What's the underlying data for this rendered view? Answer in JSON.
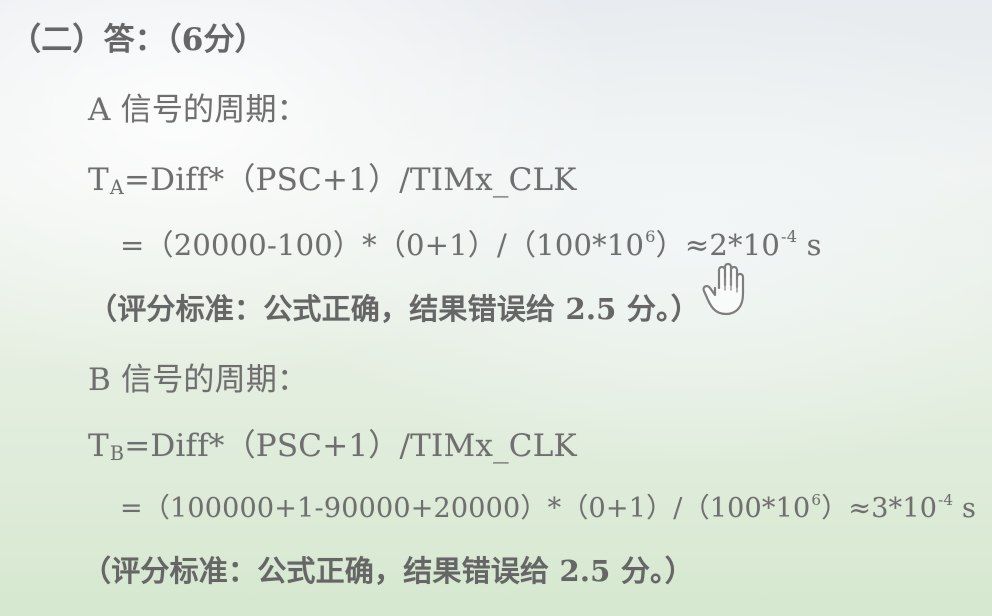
{
  "document": {
    "heading": "（二）答：（6分）",
    "a_title": "A 信号的周期：",
    "a_formula": {
      "symbol": "T",
      "subscript": "A",
      "rest": "=Diff*（PSC+1）/TIMx_CLK"
    },
    "a_calc": {
      "main": "=（20000-100）*（0+1）/（100*10",
      "exp1": "6",
      "mid": "）≈2*10",
      "exp2": "-4",
      "unit": " s"
    },
    "a_note": "（评分标准：公式正确，结果错误给 2.5 分。）",
    "b_title": "B 信号的周期：",
    "b_formula": {
      "symbol": "T",
      "subscript": "B",
      "rest": "=Diff*（PSC+1）/TIMx_CLK"
    },
    "b_calc": {
      "main": "=（100000+1-90000+20000）*（0+1）/（100*10",
      "exp1": "6",
      "mid": "）≈3*10",
      "exp2": "-4",
      "unit": " s"
    },
    "b_note": "（评分标准：公式正确，结果错误给 2.5 分。）"
  },
  "icons": {
    "pointer": "hand-pointer-icon"
  }
}
